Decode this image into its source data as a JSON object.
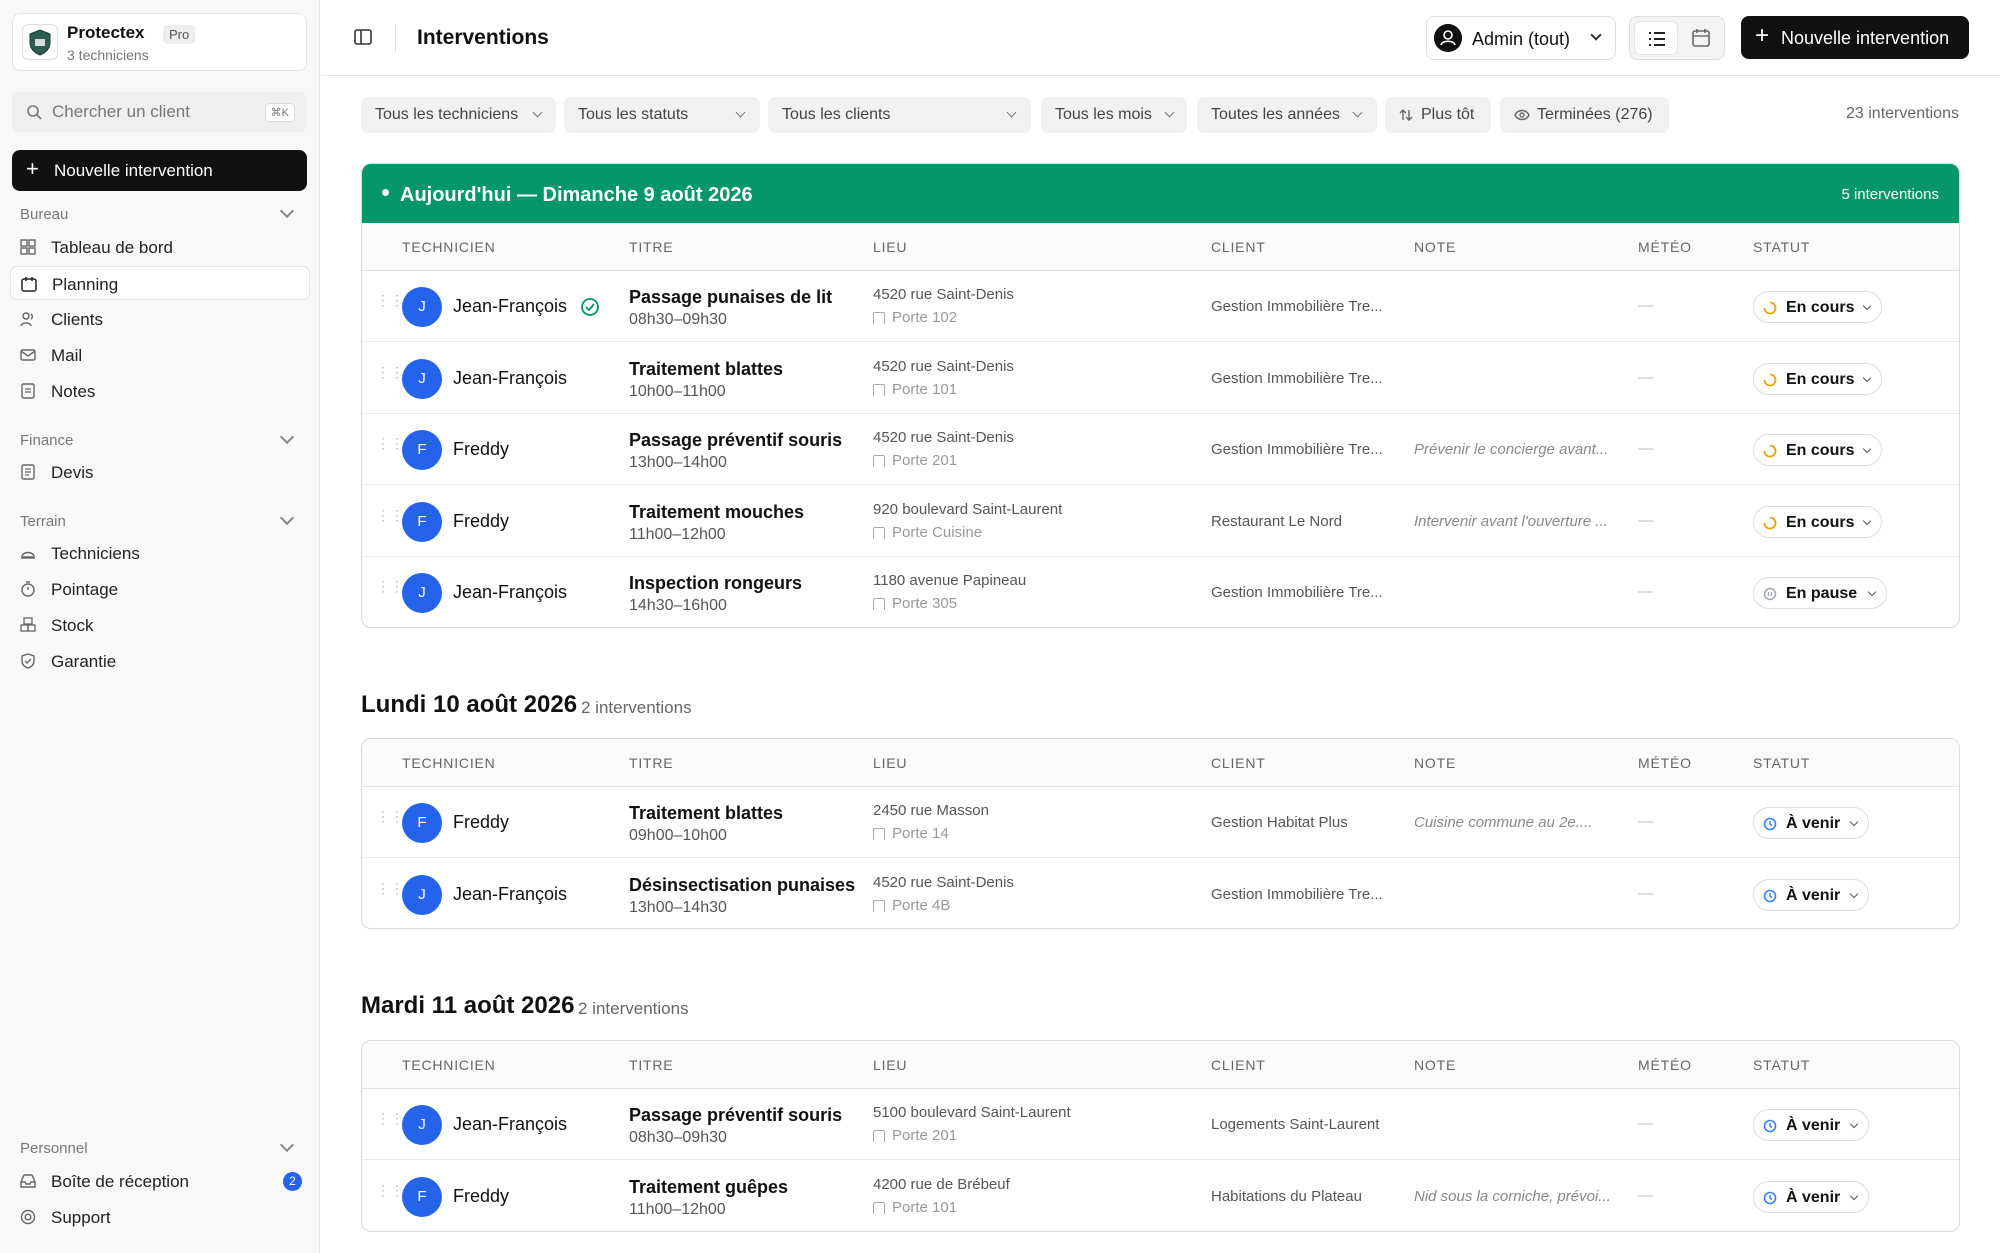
{
  "sidebar": {
    "org_name": "Protectex",
    "org_plan": "Pro",
    "org_sub": "3 techniciens",
    "search_placeholder": "Chercher un client",
    "search_kbd": "⌘K",
    "new_button": "Nouvelle intervention",
    "sections": {
      "bureau": "Bureau",
      "finance": "Finance",
      "terrain": "Terrain",
      "personnel": "Personnel"
    },
    "items": {
      "dashboard": "Tableau de bord",
      "planning": "Planning",
      "clients": "Clients",
      "mail": "Mail",
      "notes": "Notes",
      "devis": "Devis",
      "techniciens": "Techniciens",
      "pointage": "Pointage",
      "stock": "Stock",
      "garantie": "Garantie",
      "inbox": "Boîte de réception",
      "inbox_badge": "2",
      "support": "Support"
    }
  },
  "header": {
    "title": "Interventions",
    "admin_label": "Admin (tout)",
    "new_button": "Nouvelle intervention"
  },
  "filters": {
    "technicians": "Tous les techniciens",
    "statuses": "Tous les statuts",
    "clients": "Tous les clients",
    "months": "Tous les mois",
    "years": "Toutes les années",
    "sort": "Plus tôt",
    "completed": "Terminées (276)",
    "count": "23 interventions"
  },
  "columns": {
    "tech": "TECHNICIEN",
    "title": "TITRE",
    "place": "LIEU",
    "client": "CLIENT",
    "note": "NOTE",
    "meteo": "MÉTÉO",
    "status": "STATUT"
  },
  "groups": [
    {
      "title": "Aujourd'hui — Dimanche 9 août 2026",
      "count": "5 interventions",
      "rows": [
        {
          "initial": "J",
          "tech": "Jean-François",
          "title": "Passage punaises de lit",
          "time": "08h30–09h30",
          "address": "4520 rue Saint-Denis",
          "door": "Porte 102",
          "client": "Gestion Immobilière Tre...",
          "note": "",
          "meteo": "—",
          "status": "En cours"
        },
        {
          "initial": "J",
          "tech": "Jean-François",
          "title": "Traitement blattes",
          "time": "10h00–11h00",
          "address": "4520 rue Saint-Denis",
          "door": "Porte 101",
          "client": "Gestion Immobilière Tre...",
          "note": "",
          "meteo": "—",
          "status": "En cours"
        },
        {
          "initial": "F",
          "tech": "Freddy",
          "title": "Passage préventif souris",
          "time": "13h00–14h00",
          "address": "4520 rue Saint-Denis",
          "door": "Porte 201",
          "client": "Gestion Immobilière Tre...",
          "note": "Prévenir le concierge avant...",
          "meteo": "—",
          "status": "En cours"
        },
        {
          "initial": "F",
          "tech": "Freddy",
          "title": "Traitement mouches",
          "time": "11h00–12h00",
          "address": "920 boulevard Saint-Laurent",
          "door": "Porte Cuisine",
          "client": "Restaurant Le Nord",
          "note": "Intervenir avant l'ouverture ...",
          "meteo": "—",
          "status": "En cours"
        },
        {
          "initial": "J",
          "tech": "Jean-François",
          "title": "Inspection rongeurs",
          "time": "14h30–16h00",
          "address": "1180 avenue Papineau",
          "door": "Porte 305",
          "client": "Gestion Immobilière Tre...",
          "note": "",
          "meteo": "—",
          "status": "En pause"
        }
      ]
    },
    {
      "title": "Lundi 10 août 2026",
      "count": "2 interventions",
      "rows": [
        {
          "initial": "F",
          "tech": "Freddy",
          "title": "Traitement blattes",
          "time": "09h00–10h00",
          "address": "2450 rue Masson",
          "door": "Porte 14",
          "client": "Gestion Habitat Plus",
          "note": "Cuisine commune au 2e....",
          "meteo": "—",
          "status": "À venir"
        },
        {
          "initial": "J",
          "tech": "Jean-François",
          "title": "Désinsectisation punaises",
          "time": "13h00–14h30",
          "address": "4520 rue Saint-Denis",
          "door": "Porte 4B",
          "client": "Gestion Immobilière Tre...",
          "note": "",
          "meteo": "—",
          "status": "À venir"
        }
      ]
    },
    {
      "title": "Mardi 11 août 2026",
      "count": "2 interventions",
      "rows": [
        {
          "initial": "J",
          "tech": "Jean-François",
          "title": "Passage préventif souris",
          "time": "08h30–09h30",
          "address": "5100 boulevard Saint-Laurent",
          "door": "Porte 201",
          "client": "Logements Saint-Laurent",
          "note": "",
          "meteo": "—",
          "status": "À venir"
        },
        {
          "initial": "F",
          "tech": "Freddy",
          "title": "Traitement guêpes",
          "time": "11h00–12h00",
          "address": "4200 rue de Brébeuf",
          "door": "Porte 101",
          "client": "Habitations du Plateau",
          "note": "Nid sous la corniche, prévoi...",
          "meteo": "—",
          "status": "À venir"
        }
      ]
    }
  ],
  "colors": {
    "accent": "#059669",
    "avatar": "#2563eb",
    "en_cours": "#f59e0b",
    "a_venir": "#3b82f6",
    "en_pause": "#9ca3af"
  }
}
